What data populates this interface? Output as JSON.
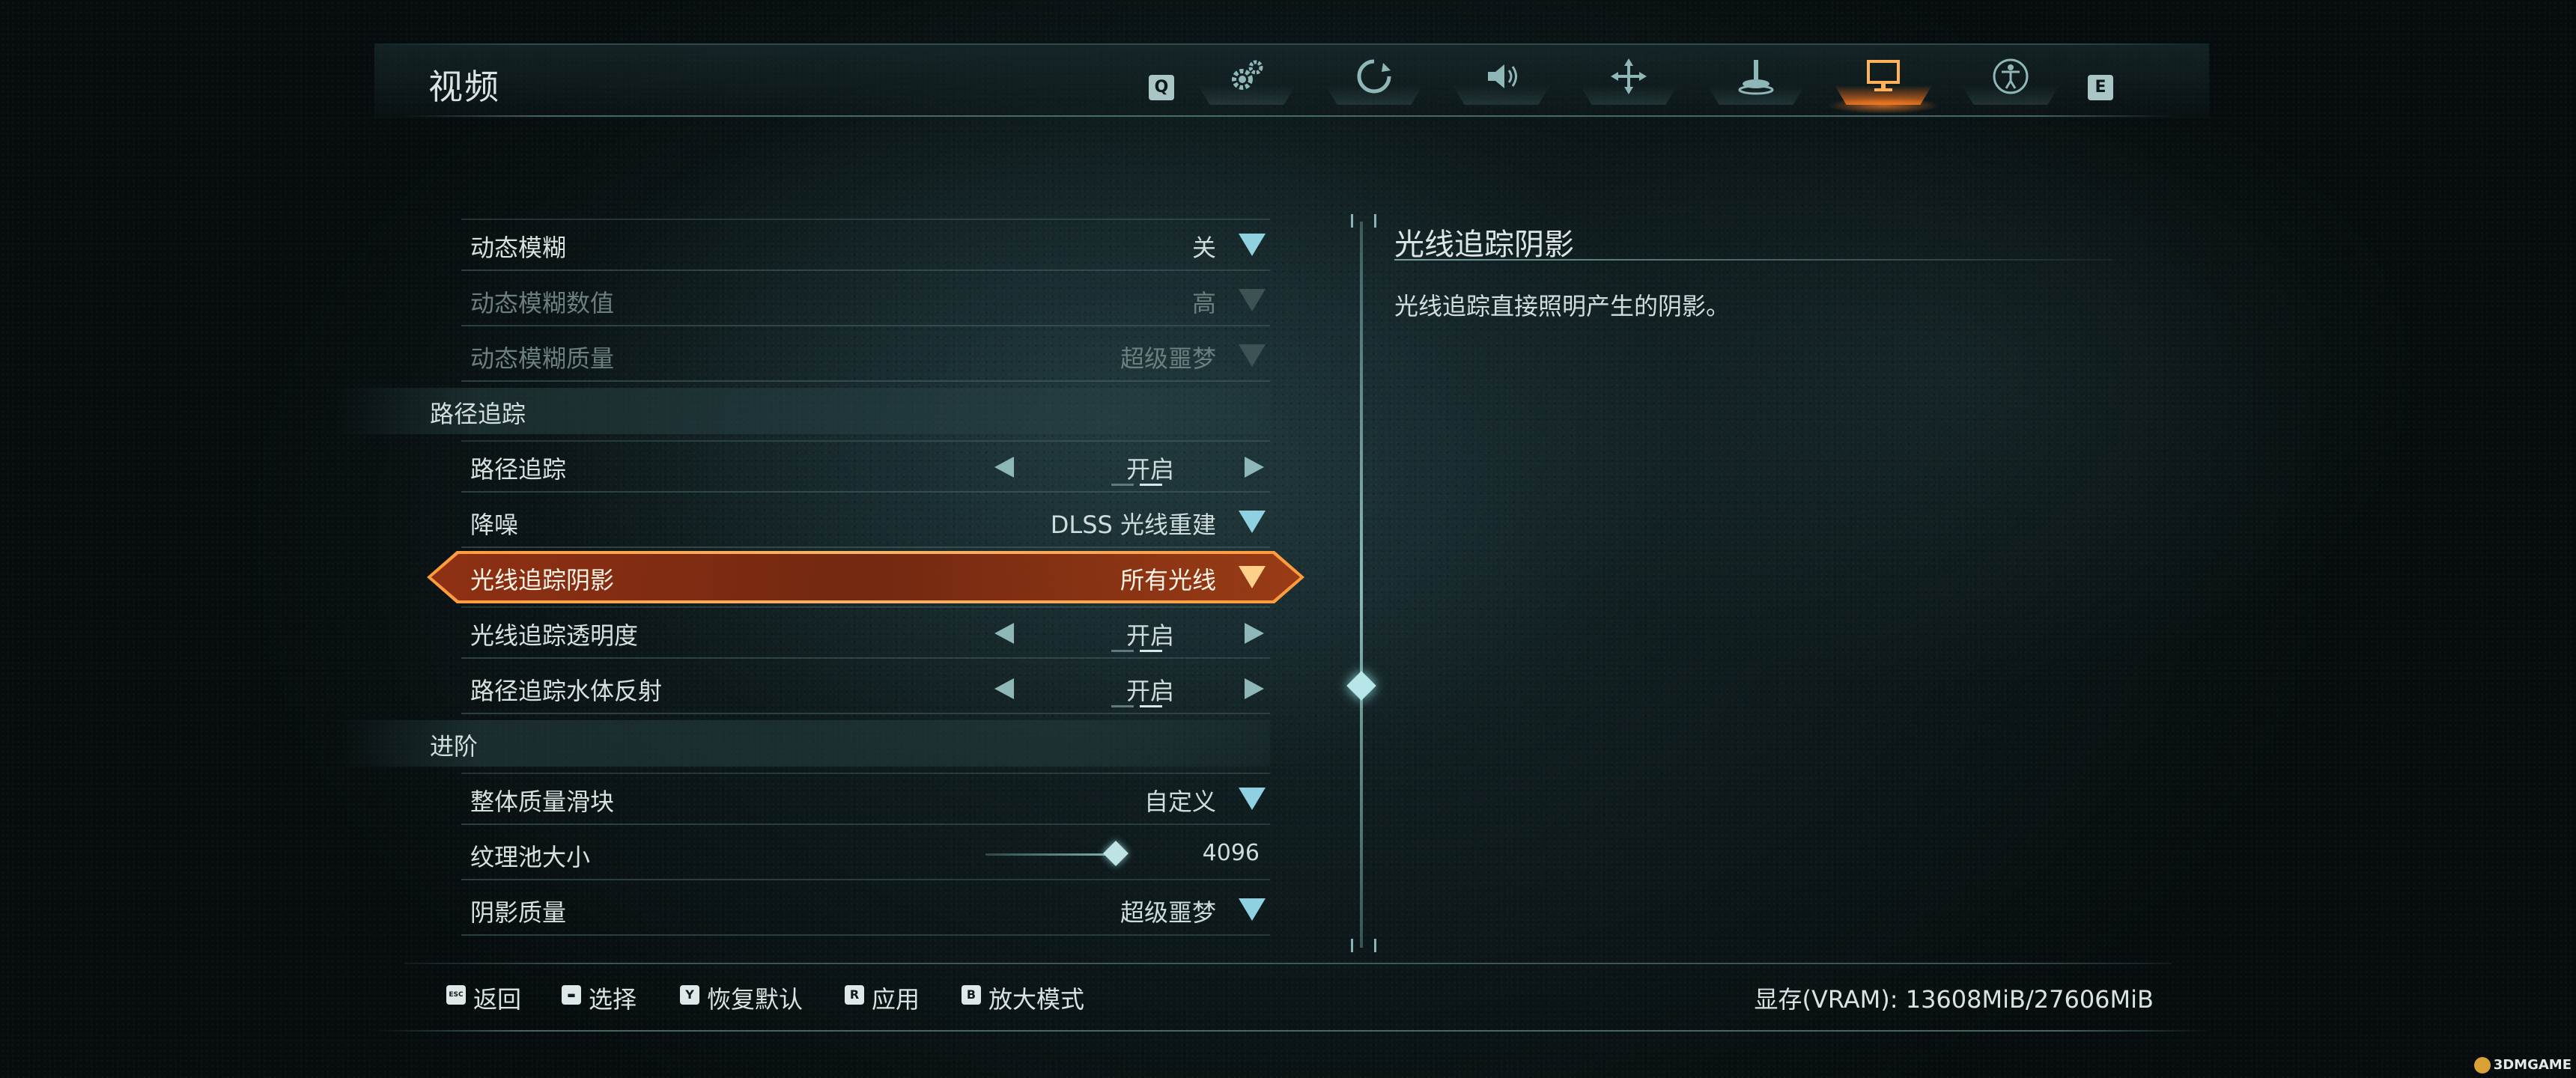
{
  "header": {
    "title": "视频",
    "prev_key": "Q",
    "next_key": "E",
    "tabs": [
      {
        "icon": "gear-icon",
        "active": false
      },
      {
        "icon": "camera-icon",
        "active": false
      },
      {
        "icon": "speaker-icon",
        "active": false
      },
      {
        "icon": "move-icon",
        "active": false
      },
      {
        "icon": "joystick-icon",
        "active": false
      },
      {
        "icon": "monitor-icon",
        "active": true
      },
      {
        "icon": "accessibility-icon",
        "active": false
      }
    ]
  },
  "settings": {
    "rows": [
      {
        "label": "动态模糊",
        "value": "关",
        "control": "dropdown",
        "disabled": false
      },
      {
        "label": "动态模糊数值",
        "value": "高",
        "control": "dropdown",
        "disabled": true
      },
      {
        "label": "动态模糊质量",
        "value": "超级噩梦",
        "control": "dropdown",
        "disabled": true
      },
      {
        "label": "路径追踪",
        "value": "开启",
        "control": "toggle",
        "disabled": false
      },
      {
        "label": "降噪",
        "value": "DLSS 光线重建",
        "control": "dropdown",
        "disabled": false
      },
      {
        "label": "光线追踪阴影",
        "value": "所有光线",
        "control": "dropdown",
        "disabled": false,
        "selected": true
      },
      {
        "label": "光线追踪透明度",
        "value": "开启",
        "control": "toggle",
        "disabled": false
      },
      {
        "label": "路径追踪水体反射",
        "value": "开启",
        "control": "toggle",
        "disabled": false
      },
      {
        "label": "整体质量滑块",
        "value": "自定义",
        "control": "dropdown",
        "disabled": false
      },
      {
        "label": "纹理池大小",
        "value": "4096",
        "control": "slider",
        "slider_fraction": 0.98,
        "disabled": false
      },
      {
        "label": "阴影质量",
        "value": "超级噩梦",
        "control": "dropdown",
        "disabled": false
      }
    ],
    "sections": {
      "path_tracing": "路径追踪",
      "advanced": "进阶"
    }
  },
  "description": {
    "title": "光线追踪阴影",
    "text": "光线追踪直接照明产生的阴影。"
  },
  "footer": {
    "actions": [
      {
        "key": "ESC",
        "label": "返回"
      },
      {
        "key": "▬",
        "label": "选择"
      },
      {
        "key": "Y",
        "label": "恢复默认"
      },
      {
        "key": "R",
        "label": "应用"
      },
      {
        "key": "B",
        "label": "放大模式"
      }
    ],
    "vram": "显存(VRAM): 13608MiB/27606MiB"
  },
  "watermark": "3DMGAME",
  "colors": {
    "accent_selected": "#ff9a3c",
    "accent_ui": "#8fd1e0",
    "background": "#0d181a"
  }
}
